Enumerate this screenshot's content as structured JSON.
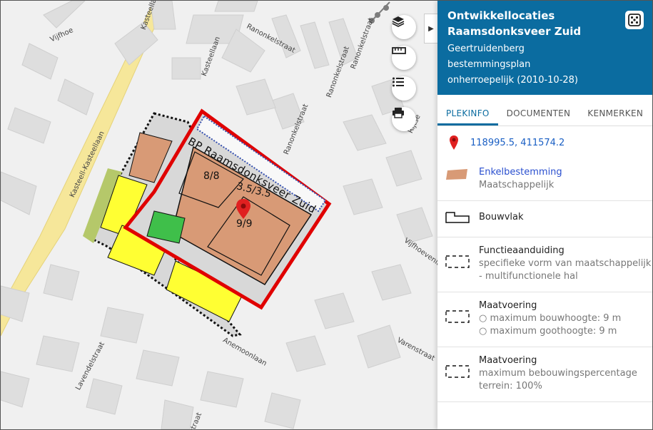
{
  "map": {
    "plan_title": "BP Raamsdonksveer Zuid",
    "labels": [
      "8/8",
      "3.5/3.5",
      "9/9"
    ],
    "streets": {
      "vijfhoe": "Vijfhoe",
      "kastel1": "Kasteellaan",
      "kastel2": "Kasteellaan",
      "ranonkel1": "Ranonkelstraat",
      "ranonkel2": "Ranonkelstraat",
      "ranonkel3": "Ranonkelstraat",
      "ranonkel4": "Ranonkelstraat",
      "kasteellkasteellaan": "Kasteell-Kasteellaan",
      "vijfhoevenlaan": "Vijfhoevenlaan",
      "rijtse": "Rijtse",
      "anemoon": "Anemoonlaan",
      "varen": "Varenstraat",
      "lavendel": "Lavendelstraat",
      "bottom": "straat"
    },
    "tools": [
      "layers-icon",
      "ruler-icon",
      "legend-list-icon",
      "print-icon"
    ]
  },
  "panel": {
    "title": "Ontwikkellocaties Raamsdonksveer Zuid",
    "municipality": "Geertruidenberg",
    "plan_type": "bestemmingsplan",
    "status": "onherroepelijk (2010-10-28)",
    "tabs": [
      "PLEKINFO",
      "DOCUMENTEN",
      "KENMERKEN"
    ],
    "active_tab": "PLEKINFO",
    "coordinates": "118995.5, 411574.2",
    "items": [
      {
        "title": "Enkelbestemming",
        "lines": [
          "Maatschappelijk"
        ],
        "symbol": "fill-salmon"
      },
      {
        "title": "Bouwvlak",
        "lines": [],
        "symbol": "bouwvlak-outline"
      },
      {
        "title": "Functieaanduiding",
        "lines": [
          "specifieke vorm van maatschappelijk - multifunctionele hal"
        ],
        "symbol": "dashed-box"
      },
      {
        "title": "Maatvoering",
        "bullets": [
          "maximum bouwhoogte: 9 m",
          "maximum goothoogte: 9 m"
        ],
        "symbol": "dashed-box"
      },
      {
        "title": "Maatvoering",
        "lines": [
          "maximum bebouwingspercentage terrein: 100%"
        ],
        "symbol": "dashed-box"
      }
    ]
  },
  "colors": {
    "accent": "#0b6ca0",
    "enkelbestemming": "#d89a76",
    "plan_border": "#e00000",
    "marker": "#e02020"
  }
}
